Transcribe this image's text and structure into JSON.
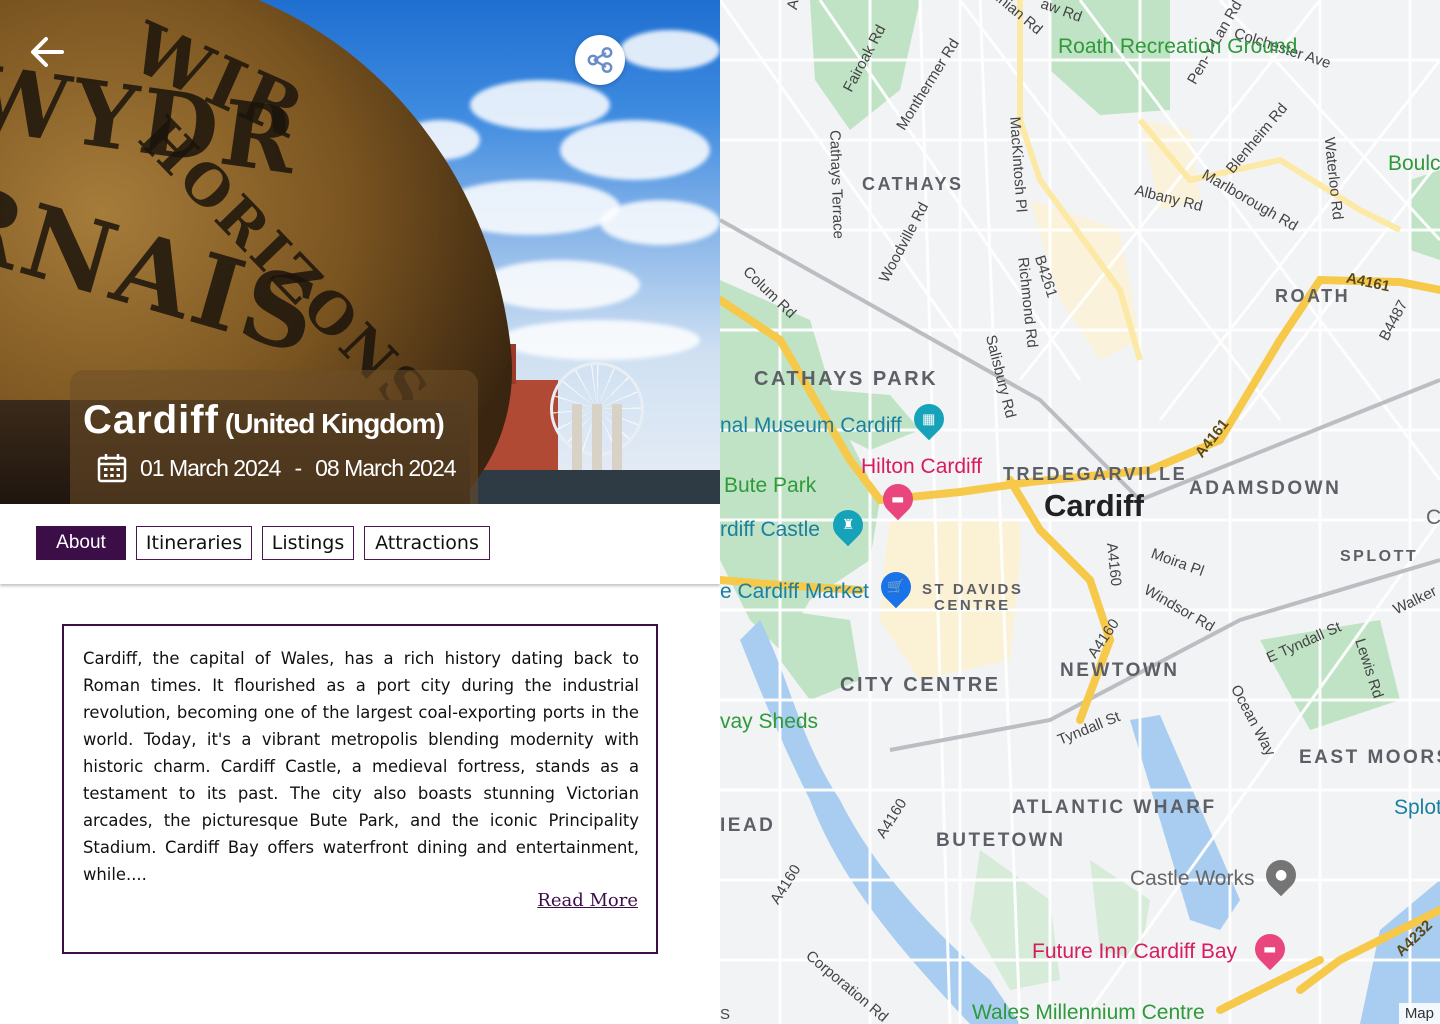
{
  "hero": {
    "city": "Cardiff",
    "country": "(United Kingdom)",
    "start_date": "01 March 2024",
    "date_separator": "-",
    "end_date": "08 March 2024",
    "building_words": [
      "WYDR",
      "RNAIS",
      "WIR",
      "HORIZONS"
    ]
  },
  "tabs": [
    {
      "label": "About",
      "active": true
    },
    {
      "label": "Itineraries",
      "active": false
    },
    {
      "label": "Listings",
      "active": false
    },
    {
      "label": "Attractions",
      "active": false
    }
  ],
  "about": {
    "text": "Cardiff, the capital of Wales, has a rich history dating back to Roman times. It flourished as a port city during the industrial revolution, becoming one of the largest coal-exporting ports in the world. Today, it's a vibrant metropolis blending modernity with historic charm. Cardiff Castle, a medieval fortress, stands as a testament to its past. The city also boasts stunning Victorian arcades, the picturesque Bute Park, and the iconic Principality Stadium. Cardiff Bay offers waterfront dining and entertainment, while....",
    "read_more": "Read More"
  },
  "map": {
    "city_label": "Cardiff",
    "attribution": "Map",
    "districts": [
      "CATHAYS",
      "ROATH",
      "CATHAYS PARK",
      "TREDEGARVILLE",
      "ADAMSDOWN",
      "SPLOTT",
      "ST DAVIDS",
      "CENTRE",
      "CITY CENTRE",
      "NEWTOWN",
      "EAST MOORS",
      "ATLANTIC WHARF",
      "BUTETOWN",
      "IEAD"
    ],
    "streets": [
      "Allen",
      "Ninian Rd",
      "aw Rd",
      "Pen-Y-Lan Rd",
      "Colchester Ave",
      "Fairoak Rd",
      "Monthermer Rd",
      "Cathays Terrace",
      "MacKintosh Pl",
      "Blenheim Rd",
      "Waterloo Rd",
      "Marlborough Rd",
      "Albany Rd",
      "Woodville Rd",
      "Colum Rd",
      "Richmond Rd",
      "B4261",
      "Salisbury Rd",
      "A4161",
      "B4487",
      "A4161",
      "A4160",
      "Moira Pl",
      "Windsor Rd",
      "A4160",
      "E Tyndall St",
      "Lewis Rd",
      "Walker",
      "Tyndall St",
      "Ocean Way",
      "A4160",
      "A4160",
      "Corporation Rd",
      "A4232",
      "S"
    ],
    "pois": [
      {
        "label": "Roath Recreation Ground",
        "kind": "park"
      },
      {
        "label": "Boulc",
        "kind": "park"
      },
      {
        "label": "nal Museum Cardiff",
        "kind": "museum"
      },
      {
        "label": "Hilton Cardiff",
        "kind": "hotel"
      },
      {
        "label": "Bute Park",
        "kind": "park"
      },
      {
        "label": "rdiff Castle",
        "kind": "castle"
      },
      {
        "label": "e Cardiff Market",
        "kind": "market"
      },
      {
        "label": "vay Sheds",
        "kind": "park"
      },
      {
        "label": "Castle Works",
        "kind": "place"
      },
      {
        "label": "Future Inn Cardiff Bay",
        "kind": "hotel"
      },
      {
        "label": "Wales Millennium Centre",
        "kind": "park"
      },
      {
        "label": "Splot",
        "kind": "teal"
      },
      {
        "label": "C",
        "kind": "gray"
      }
    ]
  },
  "colors": {
    "brand": "#3c0e48",
    "road_major": "#f7c94b",
    "park": "#bfe3c4",
    "water": "#a8cdf0"
  }
}
